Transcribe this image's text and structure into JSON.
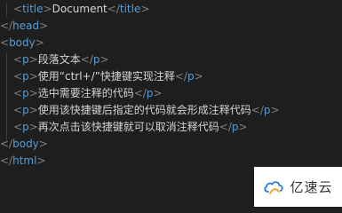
{
  "editor": {
    "lines": [
      {
        "indent": 1,
        "type": "wrapped",
        "tag": "title",
        "text": "Document"
      },
      {
        "indent": 0,
        "type": "close",
        "tag": "head"
      },
      {
        "indent": 0,
        "type": "open",
        "tag": "body"
      },
      {
        "indent": 1,
        "type": "wrapped",
        "tag": "p",
        "text": "段落文本"
      },
      {
        "indent": 1,
        "type": "wrapped",
        "tag": "p",
        "text": "使用“ctrl+/”快捷键实现注释"
      },
      {
        "indent": 1,
        "type": "wrapped",
        "tag": "p",
        "text": "选中需要注释的代码"
      },
      {
        "indent": 1,
        "type": "wrapped",
        "tag": "p",
        "text": "使用该快捷键后指定的代码就会形成注释代码"
      },
      {
        "indent": 1,
        "type": "wrapped",
        "tag": "p",
        "text": "再次点击该快捷键就可以取消注释代码"
      },
      {
        "indent": 0,
        "type": "close",
        "tag": "body"
      },
      {
        "indent": 0,
        "type": "close",
        "tag": "html"
      }
    ]
  },
  "watermark": {
    "brand_name": "亿速云",
    "logo_icon": "cloud-logo-icon"
  },
  "colors": {
    "background": "#1e1e1e",
    "tag": "#569cd6",
    "bracket": "#808080",
    "text": "#d4d4d4"
  }
}
